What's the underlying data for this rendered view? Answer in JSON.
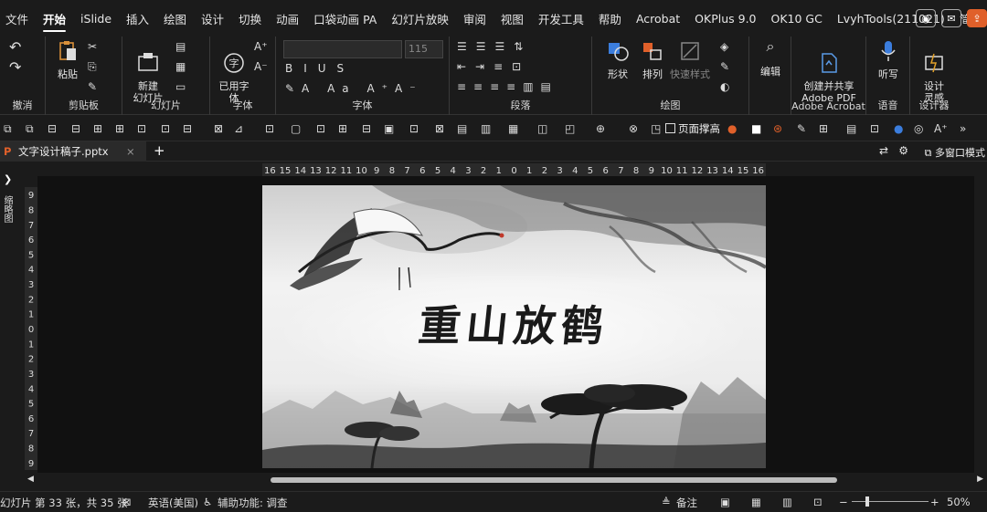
{
  "menu": {
    "tabs": [
      "文件",
      "开始",
      "iSlide",
      "插入",
      "绘图",
      "设计",
      "切换",
      "动画",
      "口袋动画 PA",
      "幻灯片放映",
      "审阅",
      "视图",
      "开发工具",
      "帮助",
      "Acrobat",
      "OKPlus 9.0",
      "OK10 GC",
      "LvyhTools(211021)",
      "简报"
    ]
  },
  "ribbon": {
    "undo_label": "撤消",
    "clipboard": {
      "paste": "粘贴",
      "label": "剪贴板"
    },
    "slides": {
      "new_slide": "新建\n幻灯片",
      "label": "幻灯片"
    },
    "font_group": {
      "used_fonts": "已用字\n体",
      "label": "字体",
      "size_placeholder": "115"
    },
    "font_label": "字体",
    "paragraph_label": "段落",
    "drawing": {
      "shape": "形状",
      "arrange": "排列",
      "quick_style": "快速样式",
      "label": "绘图"
    },
    "editing": {
      "label": "编辑"
    },
    "adobe": {
      "create": "创建并共享\nAdobe PDF",
      "label": "Adobe Acrobat"
    },
    "voice": {
      "dictate": "听写",
      "label": "语音"
    },
    "designer": {
      "design": "设计\n灵感",
      "label": "设计器"
    }
  },
  "quick_toolbar": {
    "crop_page_label": "页面撑高"
  },
  "doc_tabs": {
    "file_name": "文字设计稿子.pptx",
    "multi_window": "多窗口模式"
  },
  "side_panel": {
    "label": "缩略图"
  },
  "ruler": {
    "h_ticks": [
      "16",
      "15",
      "14",
      "13",
      "12",
      "11",
      "10",
      "9",
      "8",
      "7",
      "6",
      "5",
      "4",
      "3",
      "2",
      "1",
      "0",
      "1",
      "2",
      "3",
      "4",
      "5",
      "6",
      "7",
      "8",
      "9",
      "10",
      "11",
      "12",
      "13",
      "14",
      "15",
      "16"
    ],
    "v_ticks": [
      "9",
      "8",
      "7",
      "6",
      "5",
      "4",
      "3",
      "2",
      "1",
      "0",
      "1",
      "2",
      "3",
      "4",
      "5",
      "6",
      "7",
      "8",
      "9"
    ]
  },
  "slide": {
    "title": "重山放鹤"
  },
  "status": {
    "slide_info": "幻灯片 第 33 张，共 35 张",
    "language": "英语(美国)",
    "accessibility": "辅助功能: 调查",
    "notes": "备注",
    "zoom": "50%"
  },
  "colors": {
    "accent": "#e0602a",
    "background": "#1b1b1b",
    "slide_ink": "#1a1a1a"
  }
}
